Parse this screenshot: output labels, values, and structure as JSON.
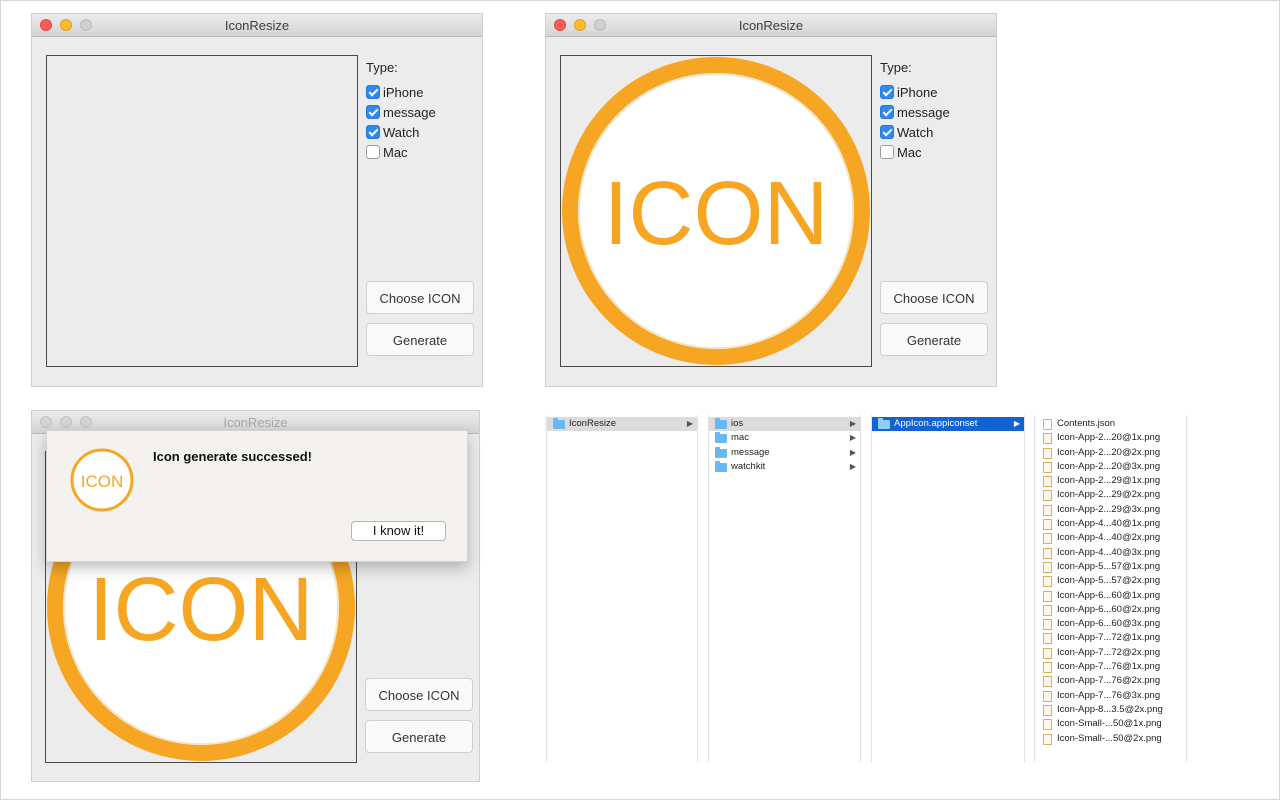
{
  "colors": {
    "accent": "#f6a623",
    "check": "#2e88f0",
    "selection": "#1063d4"
  },
  "icon_text": "ICON",
  "windows": [
    {
      "title": "IconResize",
      "type_label": "Type:",
      "options": [
        {
          "label": "iPhone",
          "checked": true
        },
        {
          "label": "message",
          "checked": true
        },
        {
          "label": "Watch",
          "checked": true
        },
        {
          "label": "Mac",
          "checked": false
        }
      ],
      "choose_label": "Choose ICON",
      "generate_label": "Generate"
    },
    {
      "title": "IconResize",
      "type_label": "Type:",
      "options": [
        {
          "label": "iPhone",
          "checked": true
        },
        {
          "label": "message",
          "checked": true
        },
        {
          "label": "Watch",
          "checked": true
        },
        {
          "label": "Mac",
          "checked": false
        }
      ],
      "choose_label": "Choose ICON",
      "generate_label": "Generate"
    },
    {
      "title": "IconResize",
      "choose_label": "Choose ICON",
      "generate_label": "Generate",
      "dialog": {
        "message": "Icon generate successed!",
        "button": "I know it!"
      }
    }
  ],
  "finder": {
    "columns": [
      [
        {
          "name": "IconResize",
          "kind": "folder",
          "state": "gray",
          "arrow": true
        }
      ],
      [
        {
          "name": "ios",
          "kind": "folder",
          "state": "gray",
          "arrow": true
        },
        {
          "name": "mac",
          "kind": "folder",
          "state": "",
          "arrow": true
        },
        {
          "name": "message",
          "kind": "folder",
          "state": "",
          "arrow": true
        },
        {
          "name": "watchkit",
          "kind": "folder",
          "state": "",
          "arrow": true
        }
      ],
      [
        {
          "name": "AppIcon.appiconset",
          "kind": "folder",
          "state": "blue",
          "arrow": true
        }
      ],
      [
        {
          "name": "Contents.json",
          "kind": "file"
        },
        {
          "name": "Icon-App-2...20@1x.png",
          "kind": "png"
        },
        {
          "name": "Icon-App-2...20@2x.png",
          "kind": "png"
        },
        {
          "name": "Icon-App-2...20@3x.png",
          "kind": "png"
        },
        {
          "name": "Icon-App-2...29@1x.png",
          "kind": "png"
        },
        {
          "name": "Icon-App-2...29@2x.png",
          "kind": "png"
        },
        {
          "name": "Icon-App-2...29@3x.png",
          "kind": "png"
        },
        {
          "name": "Icon-App-4...40@1x.png",
          "kind": "png"
        },
        {
          "name": "Icon-App-4...40@2x.png",
          "kind": "png"
        },
        {
          "name": "Icon-App-4...40@3x.png",
          "kind": "png"
        },
        {
          "name": "Icon-App-5...57@1x.png",
          "kind": "png"
        },
        {
          "name": "Icon-App-5...57@2x.png",
          "kind": "png"
        },
        {
          "name": "Icon-App-6...60@1x.png",
          "kind": "png"
        },
        {
          "name": "Icon-App-6...60@2x.png",
          "kind": "png"
        },
        {
          "name": "Icon-App-6...60@3x.png",
          "kind": "png"
        },
        {
          "name": "Icon-App-7...72@1x.png",
          "kind": "png"
        },
        {
          "name": "Icon-App-7...72@2x.png",
          "kind": "png"
        },
        {
          "name": "Icon-App-7...76@1x.png",
          "kind": "png"
        },
        {
          "name": "Icon-App-7...76@2x.png",
          "kind": "png"
        },
        {
          "name": "Icon-App-7...76@3x.png",
          "kind": "png"
        },
        {
          "name": "Icon-App-8...3.5@2x.png",
          "kind": "png"
        },
        {
          "name": "Icon-Small-...50@1x.png",
          "kind": "png"
        },
        {
          "name": "Icon-Small-...50@2x.png",
          "kind": "png"
        }
      ]
    ]
  }
}
